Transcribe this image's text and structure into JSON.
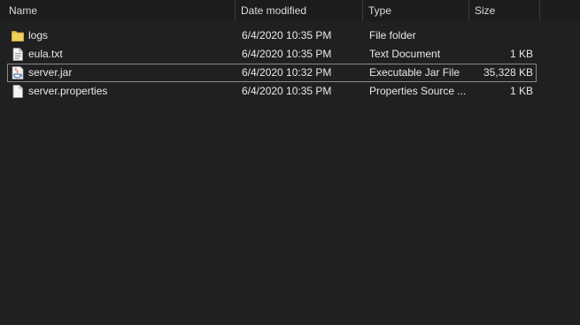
{
  "columns": {
    "name": "Name",
    "date": "Date modified",
    "type": "Type",
    "size": "Size"
  },
  "sort_indicator": "^",
  "files": [
    {
      "name": "logs",
      "date": "6/4/2020 10:35 PM",
      "type": "File folder",
      "size": "",
      "icon": "folder-icon"
    },
    {
      "name": "eula.txt",
      "date": "6/4/2020 10:35 PM",
      "type": "Text Document",
      "size": "1 KB",
      "icon": "text-file-icon"
    },
    {
      "name": "server.jar",
      "date": "6/4/2020 10:32 PM",
      "type": "Executable Jar File",
      "size": "35,328 KB",
      "icon": "java-jar-icon"
    },
    {
      "name": "server.properties",
      "date": "6/4/2020 10:35 PM",
      "type": "Properties Source ...",
      "size": "1 KB",
      "icon": "properties-file-icon"
    }
  ],
  "colors": {
    "background": "#202020",
    "folder": "#e8c04a",
    "selection_border": "#8a8a8a"
  }
}
